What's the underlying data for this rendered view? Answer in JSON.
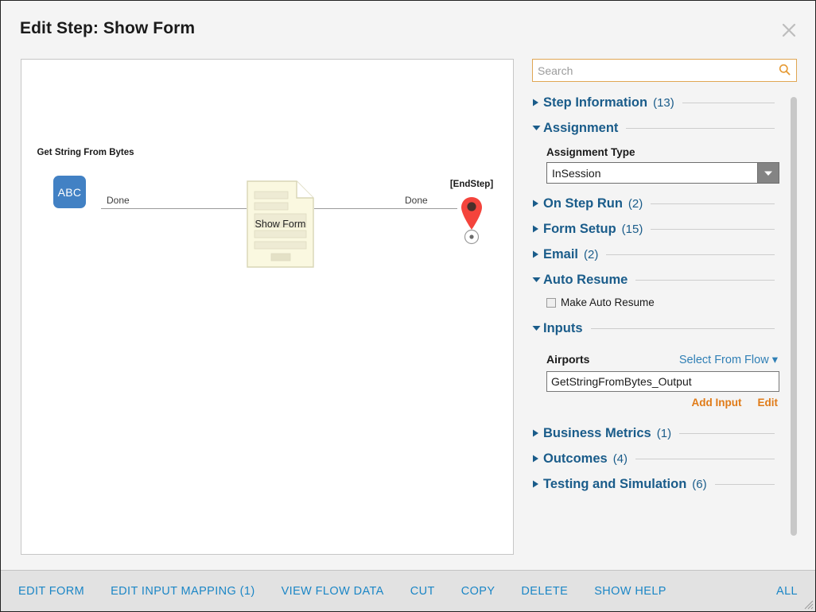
{
  "dialog": {
    "title": "Edit Step: Show Form",
    "close_icon": "close-icon"
  },
  "canvas": {
    "nodes": [
      {
        "id": "get-string-from-bytes",
        "label": "Get String From Bytes",
        "badge": "ABC",
        "color": "#4281c4"
      },
      {
        "id": "show-form",
        "label": "Show Form",
        "color": "#faf8e0"
      },
      {
        "id": "end-step",
        "label": "[EndStep]",
        "color": "#f4443c"
      }
    ],
    "edges": [
      {
        "label": "Done",
        "from": "get-string-from-bytes",
        "to": "show-form"
      },
      {
        "label": "Done",
        "from": "show-form",
        "to": "end-step"
      }
    ]
  },
  "search": {
    "placeholder": "Search",
    "value": "",
    "icon": "search-icon",
    "border_color": "#e0a653"
  },
  "properties": {
    "sections": [
      {
        "title": "Step Information",
        "count": "(13)",
        "expanded": false
      },
      {
        "title": "Assignment",
        "count": "",
        "expanded": true
      },
      {
        "title": "On Step Run",
        "count": "(2)",
        "expanded": false
      },
      {
        "title": "Form Setup",
        "count": "(15)",
        "expanded": false
      },
      {
        "title": "Email",
        "count": "(2)",
        "expanded": false
      },
      {
        "title": "Auto Resume",
        "count": "",
        "expanded": true
      },
      {
        "title": "Inputs",
        "count": "",
        "expanded": true
      },
      {
        "title": "Business Metrics",
        "count": "(1)",
        "expanded": false
      },
      {
        "title": "Outcomes",
        "count": "(4)",
        "expanded": false
      },
      {
        "title": "Testing and Simulation",
        "count": "(6)",
        "expanded": false
      }
    ],
    "assignment": {
      "field_label": "Assignment Type",
      "selected": "InSession"
    },
    "auto_resume": {
      "checkbox_label": "Make Auto Resume",
      "checked": false
    },
    "inputs": {
      "name": "Airports",
      "select_from_flow": "Select From Flow",
      "value": "GetStringFromBytes_Output",
      "add_input": "Add Input",
      "edit": "Edit"
    }
  },
  "footer": {
    "buttons": [
      "EDIT FORM",
      "EDIT INPUT MAPPING (1)",
      "VIEW FLOW DATA",
      "CUT",
      "COPY",
      "DELETE",
      "SHOW HELP"
    ],
    "all": "ALL",
    "link_color": "#1b86c6"
  }
}
